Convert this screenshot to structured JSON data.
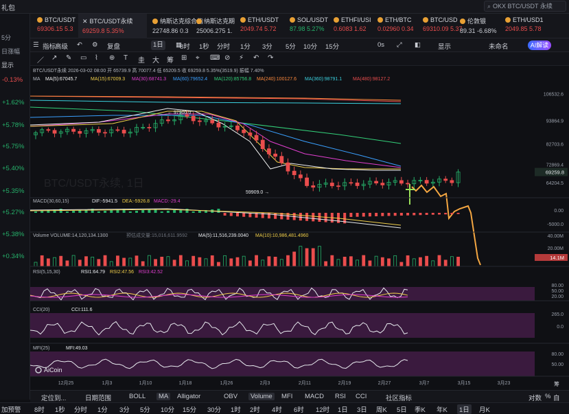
{
  "topbar": {
    "gift_label": "礼包",
    "search_placeholder": "OKX BTC/USDT 永续"
  },
  "left_panel": {
    "rows": [
      "",
      "5分",
      "日涨幅",
      "显示"
    ],
    "pcts": [
      {
        "v": "-0.13%",
        "c": "#ea4d4d"
      },
      {
        "v": "+1.62%",
        "c": "#26b36b"
      },
      {
        "v": "+5.78%",
        "c": "#26b36b"
      },
      {
        "v": "+5.75%",
        "c": "#26b36b"
      },
      {
        "v": "+5.40%",
        "c": "#26b36b"
      },
      {
        "v": "+5.35%",
        "c": "#26b36b"
      },
      {
        "v": "+5.27%",
        "c": "#26b36b"
      },
      {
        "v": "+5.38%",
        "c": "#26b36b"
      },
      {
        "v": "+0.34%",
        "c": "#26b36b"
      }
    ]
  },
  "tabs": [
    {
      "name": "BTC/USDT",
      "price": "69306.15",
      "chg": "5.3",
      "color": "red"
    },
    {
      "name": "BTC/USDT永续",
      "price": "69259.8",
      "chg": "5.35%",
      "color": "red",
      "active": true
    },
    {
      "name": "纳斯达克综合指",
      "price": "22748.86",
      "chg": "0.3",
      "color": "white"
    },
    {
      "name": "纳斯达克期",
      "price": "25006.275",
      "chg": "1.",
      "color": "white"
    },
    {
      "name": "ETH/USDT",
      "price": "2049.74",
      "chg": "5.72",
      "color": "red"
    },
    {
      "name": "SOL/USDT",
      "price": "87.98",
      "chg": "5.27%",
      "color": "green"
    },
    {
      "name": "ETHFI/USI",
      "price": "0.6083",
      "chg": "1.62",
      "color": "red"
    },
    {
      "name": "ETH/BTC",
      "price": "0.02960",
      "chg": "0.34",
      "color": "red"
    },
    {
      "name": "BTC/USD",
      "price": "69310.09",
      "chg": "5.37",
      "color": "red"
    },
    {
      "name": "伦敦银",
      "price": "89.31",
      "chg": "-6.68%",
      "color": "white"
    },
    {
      "name": "ETH/USD1",
      "price": "2049.85",
      "chg": "5.78",
      "color": "red"
    }
  ],
  "toolbar": {
    "items": [
      "指标",
      "高级",
      "",
      "",
      "复盘",
      "1日",
      "",
      "8时",
      "1秒",
      "分时",
      "1分",
      "3分",
      "5分",
      "10分",
      "15分",
      "0s",
      "",
      "",
      "显示",
      "未命名"
    ],
    "ai_label": "AI解读"
  },
  "chart": {
    "title": "BTC/USDT永续",
    "date": "2026-03-02 08:00",
    "ohlc": "开 65739.9 高 70077.4 低 65209.5 收 69259.8 5.35%(3519.9) 振幅 7.40%",
    "ma_label": "MA",
    "ma_values": [
      {
        "t": "MA(5):67045.7",
        "c": "#f2f2f2"
      },
      {
        "t": "MA(15):67009.3",
        "c": "#f2d04b"
      },
      {
        "t": "MA(30):68741.3",
        "c": "#e23fd0"
      },
      {
        "t": "MA(60):79652.4",
        "c": "#3aa0ff"
      },
      {
        "t": "MA(120):85756.8",
        "c": "#33d17a"
      },
      {
        "t": "MA(240):100127.6",
        "c": "#ff8a3d"
      },
      {
        "t": "MA(360):98791.1",
        "c": "#3bd2e0"
      },
      {
        "t": "MA(480):98127.2",
        "c": "#ea4d4d"
      }
    ],
    "y_ticks": [
      "106532.6",
      "93864.9",
      "82703.6",
      "72869.4",
      "64204.5"
    ],
    "current_price": "69259.8",
    "high_label": "97900.0",
    "low_label": "59909.0",
    "watermark": "BTC/USDT永续, 1日",
    "macd": {
      "label": "MACD(30,60,15)",
      "dif": "DIF:-5941.5",
      "dea": "DEA:-5926.8",
      "macd": "MACD:-29.4",
      "ticks": [
        "0.00",
        "-5000.0"
      ]
    },
    "volume": {
      "label": "Volume",
      "v1": "VOLUME:14,120,134.1300",
      "v2": "预估成交量:15,016,611.9592",
      "ma5": "MA(5):11,516,239.0040",
      "ma10": "MA(10):10,986,481.4960",
      "ticks": [
        "40.00M",
        "20.00M"
      ],
      "current": "14.1M"
    },
    "rsi": {
      "label": "RSI(5,15,30)",
      "r1": "RSI1:64.79",
      "r2": "RSI2:47.56",
      "r3": "RSI3:42.52",
      "ticks": [
        "80.00",
        "50.00",
        "20.00"
      ]
    },
    "cci": {
      "label": "CCI(20)",
      "v": "CCI:111.6",
      "ticks": [
        "265.0",
        "0.0"
      ]
    },
    "mfi": {
      "label": "MFI(25)",
      "v": "MFI:49.03",
      "ticks": [
        "80.00",
        "50.00"
      ]
    },
    "x_ticks": [
      "12月25",
      "1月3",
      "1月10",
      "1月18",
      "1月26",
      "2月3",
      "2月11",
      "2月19",
      "2月27",
      "3月7",
      "3月15",
      "3月23"
    ],
    "logo": "AiCoin"
  },
  "bottom1": [
    "定位到...",
    "日期范围",
    "BOLL",
    "MA",
    "Alligator",
    "OBV",
    "Volume",
    "MFI",
    "MACD",
    "RSI",
    "CCI",
    "社区指标",
    "对数",
    "%",
    "自"
  ],
  "bottom2": [
    "加预警",
    "8时",
    "1秒",
    "分时",
    "1分",
    "3分",
    "5分",
    "10分",
    "15分",
    "30分",
    "1时",
    "2时",
    "4时",
    "6时",
    "12时",
    "1日",
    "3日",
    "周K",
    "5日",
    "季K",
    "年K",
    "1日",
    "月K"
  ],
  "right_label": "筹"
}
